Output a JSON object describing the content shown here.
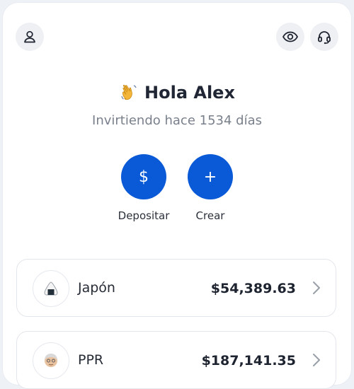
{
  "header": {
    "profile_icon": "user-icon",
    "visibility_icon": "eye-icon",
    "support_icon": "headset-icon"
  },
  "greeting": {
    "emoji": "👋",
    "text": "Hola Alex",
    "subtitle": "Invirtiendo hace 1534 días"
  },
  "actions": [
    {
      "symbol": "$",
      "label": "Depositar"
    },
    {
      "symbol": "+",
      "label": "Crear"
    }
  ],
  "accounts": [
    {
      "name": "Japón",
      "value": "$54,389.63",
      "icon": "onigiri-icon"
    },
    {
      "name": "PPR",
      "value": "$187,141.35",
      "icon": "elder-avatar-icon"
    }
  ],
  "colors": {
    "accent": "#0a59d7",
    "background": "#eef2f7"
  }
}
